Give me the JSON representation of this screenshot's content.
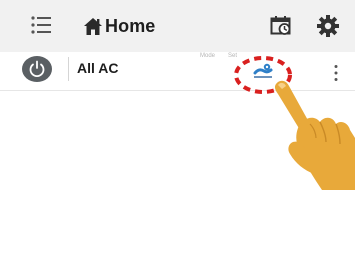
{
  "app": {
    "title": "Home"
  },
  "header": {
    "menu_icon": "menu-icon",
    "home_icon": "home-icon",
    "schedule_icon": "calendar-clock-icon",
    "settings_icon": "gear-icon"
  },
  "device_row": {
    "name": "All AC",
    "column_headers": [
      "Mode",
      "Set"
    ],
    "power_icon": "power-icon",
    "mode_icon": "fan-mode-icon",
    "more_icon": "more-vertical-icon"
  },
  "annotation": {
    "highlight": "red-dashed-circle",
    "pointer": "hand-pointer-icon"
  },
  "colors": {
    "header_bg": "#f1f1f1",
    "icon_dark": "#444444",
    "power_bg": "#5a5f63",
    "mode_blue": "#2e7fc8",
    "highlight_red": "#d9201f",
    "hand_skin": "#e8a93a"
  }
}
